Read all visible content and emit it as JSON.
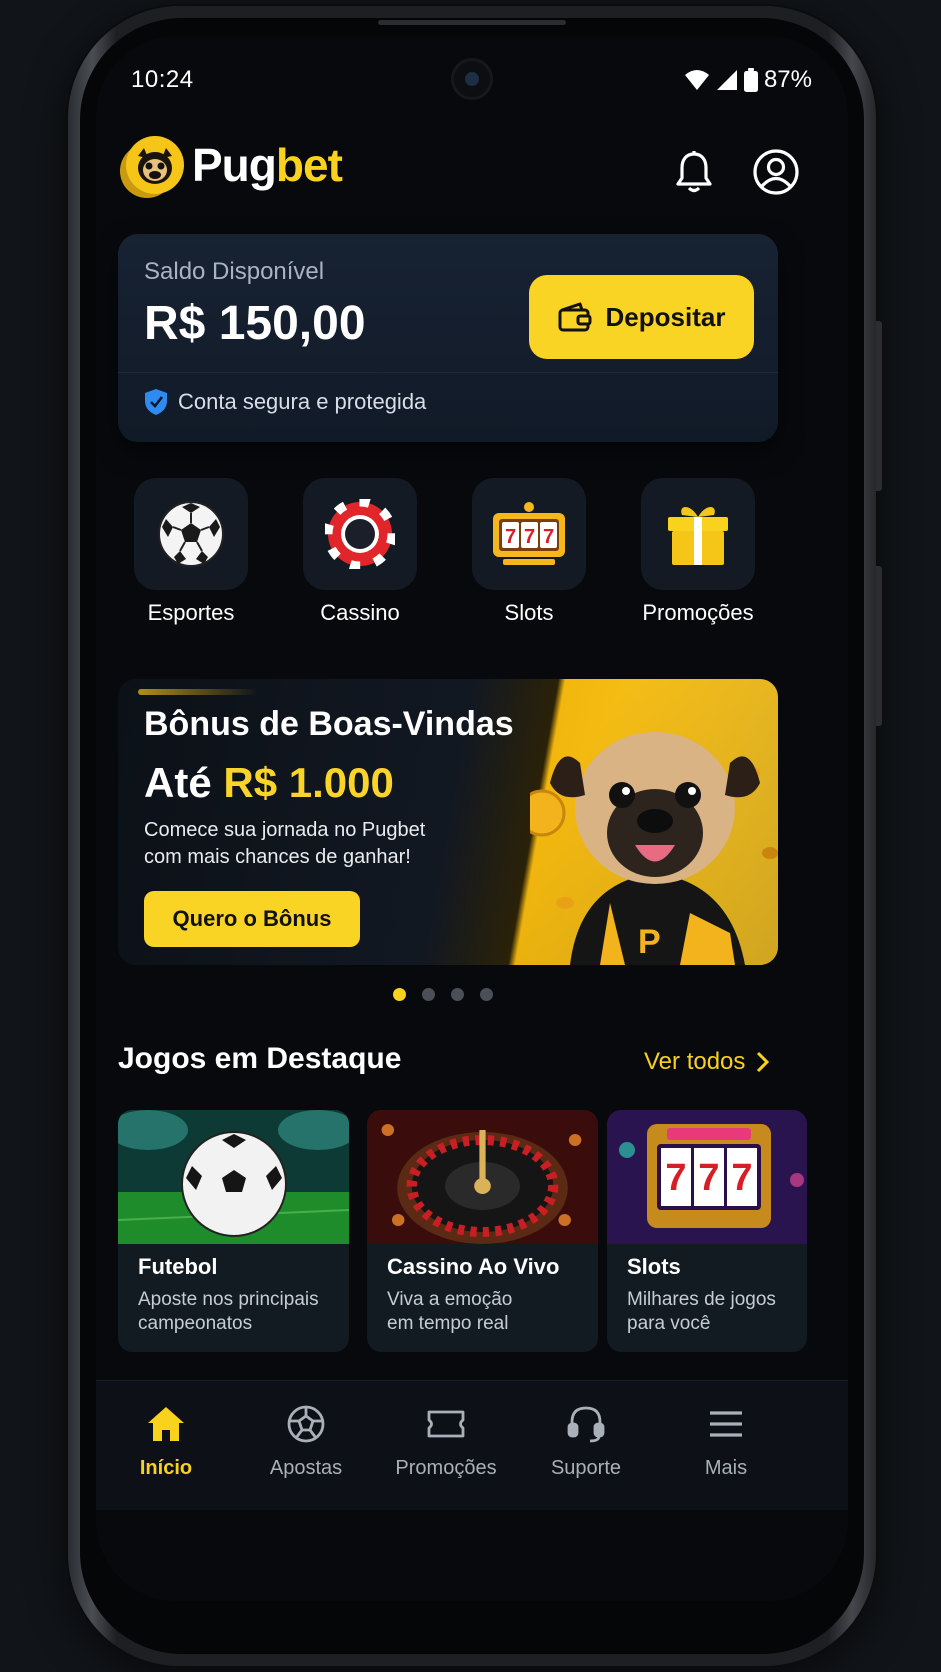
{
  "status": {
    "time": "10:24",
    "battery": "87%"
  },
  "header": {
    "brand_part1": "Pug",
    "brand_part2": "bet"
  },
  "balance": {
    "label": "Saldo Disponível",
    "value": "R$ 150,00",
    "deposit_label": "Depositar",
    "secure_text": "Conta segura e protegida"
  },
  "categories": [
    {
      "label": "Esportes",
      "icon": "soccer-ball-icon"
    },
    {
      "label": "Cassino",
      "icon": "casino-chip-icon"
    },
    {
      "label": "Slots",
      "icon": "slot-machine-icon"
    },
    {
      "label": "Promoções",
      "icon": "gift-icon"
    }
  ],
  "banner": {
    "title": "Bônus de Boas-Vindas",
    "sub_prefix": "Até",
    "sub_amount": "R$ 1.000",
    "desc_line1": "Comece sua jornada no Pugbet",
    "desc_line2": "com mais chances de ganhar!",
    "cta": "Quero o Bônus",
    "slides": 4,
    "active_slide": 1
  },
  "featured": {
    "title": "Jogos em Destaque",
    "see_all": "Ver todos",
    "games": [
      {
        "name": "Futebol",
        "desc_line1": "Aposte nos principais",
        "desc_line2": "campeonatos"
      },
      {
        "name": "Cassino Ao Vivo",
        "desc_line1": "Viva a emoção",
        "desc_line2": "em tempo real"
      },
      {
        "name": "Slots",
        "desc_line1": "Milhares de jogos",
        "desc_line2": "para você"
      }
    ]
  },
  "nav": [
    {
      "label": "Início",
      "icon": "home-icon",
      "active": true
    },
    {
      "label": "Apostas",
      "icon": "ball-icon",
      "active": false
    },
    {
      "label": "Promoções",
      "icon": "ticket-icon",
      "active": false
    },
    {
      "label": "Suporte",
      "icon": "headset-icon",
      "active": false
    },
    {
      "label": "Mais",
      "icon": "menu-icon",
      "active": false
    }
  ],
  "colors": {
    "accent": "#f8d21c",
    "background": "#07090c",
    "card": "#141a24"
  }
}
